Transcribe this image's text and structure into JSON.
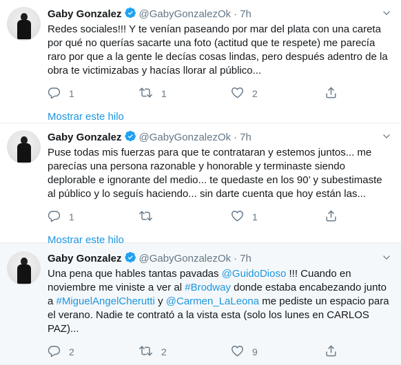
{
  "tweets": [
    {
      "name": "Gaby Gonzalez",
      "handle": "@GabyGonzalezOk",
      "time": "7h",
      "text_segments": [
        {
          "text": "Redes sociales!!! Y te venían paseando por mar del plata con una careta por qué no querías sacarte una foto (actitud que te respete) me parecía raro por que a la gente le decías cosas lindas, pero después adentro de la obra te victimizabas y hacías llorar al público...",
          "link": false
        }
      ],
      "replies": "1",
      "retweets": "1",
      "likes": "2",
      "show_thread": "Mostrar este hilo"
    },
    {
      "name": "Gaby Gonzalez",
      "handle": "@GabyGonzalezOk",
      "time": "7h",
      "text_segments": [
        {
          "text": "Puse todas mis fuerzas para que te contrataran y estemos juntos... me parecías una persona razonable y honorable y terminaste siendo deplorable e ignorante del medio... te quedaste en los 90’ y subestimaste al público y lo seguís haciendo... sin darte cuenta que hoy están las...",
          "link": false
        }
      ],
      "replies": "1",
      "retweets": "",
      "likes": "1",
      "show_thread": "Mostrar este hilo"
    },
    {
      "name": "Gaby Gonzalez",
      "handle": "@GabyGonzalezOk",
      "time": "7h",
      "text_segments": [
        {
          "text": "Una pena que hables tantas pavadas ",
          "link": false
        },
        {
          "text": "@GuidoDioso",
          "link": true
        },
        {
          "text": " !!! Cuando en noviembre me viniste a ver al ",
          "link": false
        },
        {
          "text": "#Brodway",
          "link": true
        },
        {
          "text": " donde estaba encabezando junto a ",
          "link": false
        },
        {
          "text": "#MiguelAngelCherutti",
          "link": true
        },
        {
          "text": " y ",
          "link": false
        },
        {
          "text": "@Carmen_LaLeona",
          "link": true
        },
        {
          "text": " me pediste un espacio para el verano. Nadie te contrató a la vista esta (solo los lunes en CARLOS PAZ)...",
          "link": false
        }
      ],
      "replies": "2",
      "retweets": "2",
      "likes": "9",
      "show_thread": ""
    }
  ],
  "colors": {
    "text": "#14171a",
    "muted": "#657786",
    "link": "#1b95e0",
    "verified": "#1da1f2",
    "divider": "#e6ecf0",
    "highlight_bg": "#f5f8fa"
  },
  "icons": [
    "avatar",
    "verified-badge-icon",
    "caret-down-icon",
    "reply-icon",
    "retweet-icon",
    "like-icon",
    "share-icon"
  ]
}
